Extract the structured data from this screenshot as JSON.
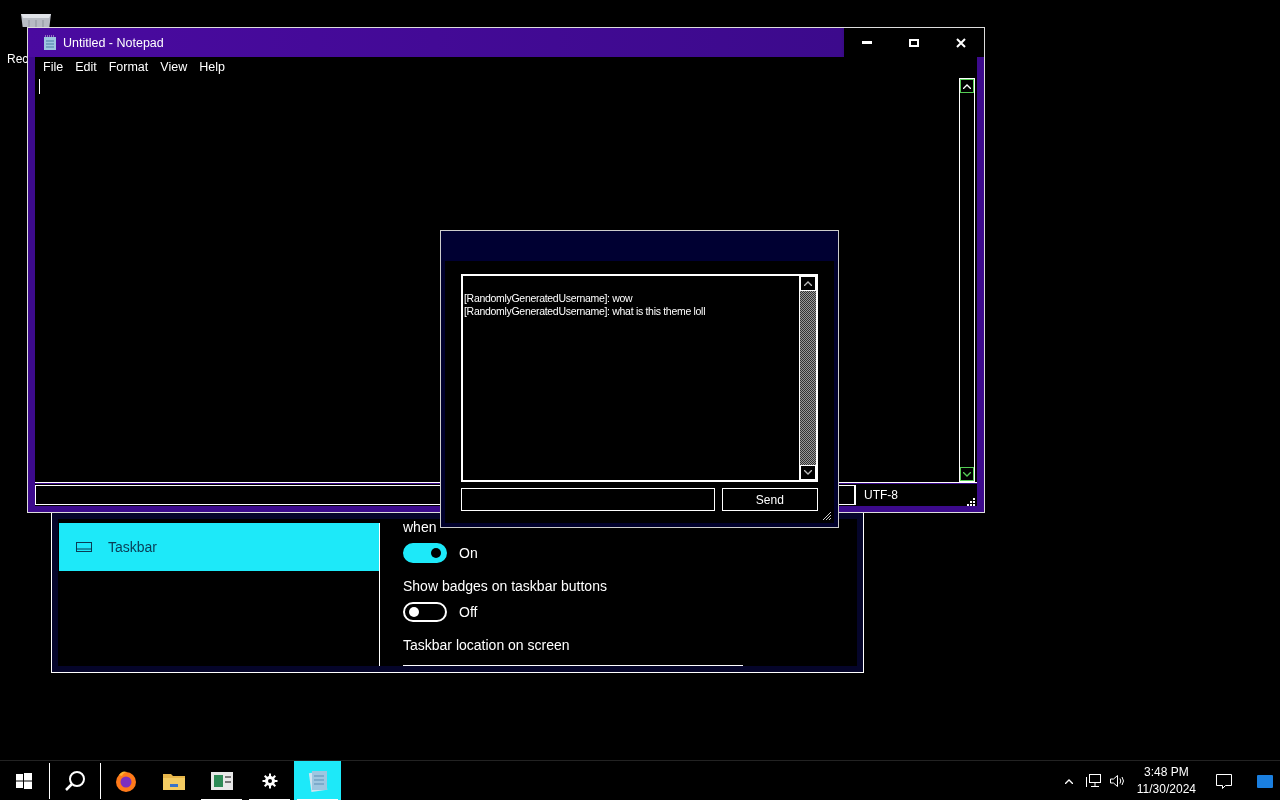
{
  "desktop": {
    "icons": [
      {
        "label": "Rec"
      }
    ]
  },
  "settings": {
    "nav": [
      {
        "label": "Taskbar",
        "selected": true
      }
    ],
    "items": [
      {
        "kind": "label",
        "text": "when"
      },
      {
        "kind": "toggle",
        "on": true,
        "state_label": "On"
      },
      {
        "kind": "label",
        "text": "Show badges on taskbar buttons"
      },
      {
        "kind": "toggle",
        "on": false,
        "state_label": "Off"
      },
      {
        "kind": "label",
        "text": "Taskbar location on screen"
      },
      {
        "kind": "dropdown"
      }
    ]
  },
  "notepad": {
    "title": "Untitled - Notepad",
    "menu": [
      "File",
      "Edit",
      "Format",
      "View",
      "Help"
    ],
    "status_bar": {
      "encoding": "UTF-8"
    }
  },
  "chat": {
    "messages": [
      "[RandomlyGeneratedUsername]: wow",
      "[RandomlyGeneratedUsername]: what is this theme loll"
    ],
    "send_button": "Send"
  },
  "taskbar": {
    "apps": [
      {
        "kind": "firefox",
        "running": false,
        "selected": false
      },
      {
        "kind": "folder",
        "running": false,
        "selected": false
      },
      {
        "kind": "app",
        "running": true,
        "selected": false
      },
      {
        "kind": "settings",
        "running": true,
        "selected": false
      },
      {
        "kind": "notepad",
        "running": true,
        "selected": true
      }
    ],
    "clock": {
      "time": "3:48 PM",
      "date": "11/30/2024"
    }
  }
}
